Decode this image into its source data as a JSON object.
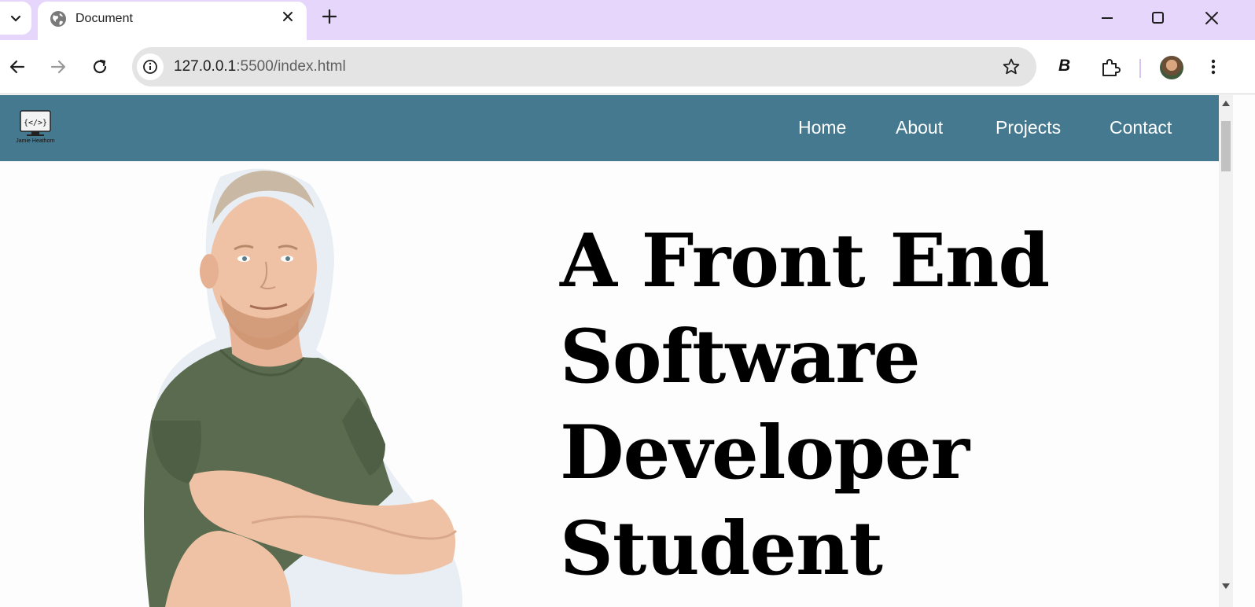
{
  "browser": {
    "tab": {
      "title": "Document",
      "icon": "globe-icon"
    },
    "address_bar": {
      "host": "127.0.0.1",
      "rest": ":5500/index.html"
    },
    "extension_label": "B",
    "colors": {
      "tabstrip": "#e7d6fb",
      "omnibox": "#e4e4e4"
    }
  },
  "site": {
    "logo": {
      "glyph": "{</>}",
      "caption": "Jamie Heathorn"
    },
    "nav": {
      "home": "Home",
      "about": "About",
      "projects": "Projects",
      "contact": "Contact"
    },
    "hero": {
      "line1": "A Front End",
      "line2": "Software",
      "line3": "Developer",
      "line4": "Student"
    },
    "colors": {
      "nav_bg": "#44798f",
      "shirt": "#5a6b4f",
      "skin": "#efc2a6"
    }
  }
}
